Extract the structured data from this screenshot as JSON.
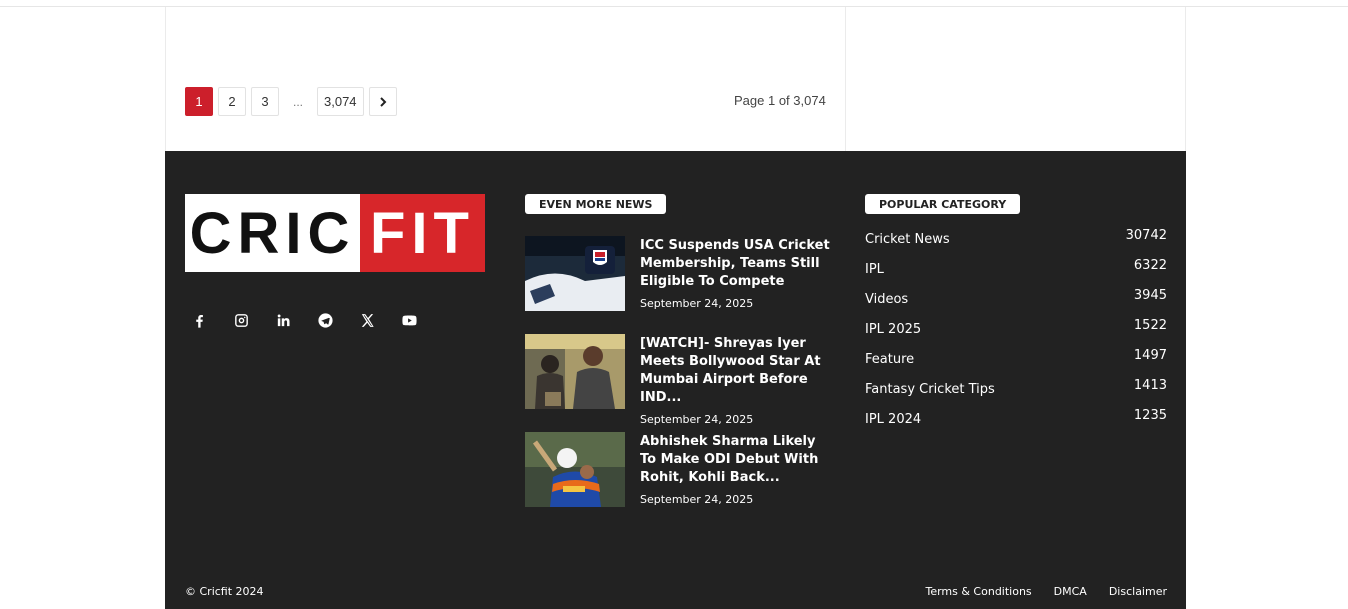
{
  "pagination": {
    "pages": [
      "1",
      "2",
      "3"
    ],
    "ellipsis": "...",
    "last_page": "3,074",
    "next_icon": "chevron-right-icon",
    "page_info": "Page 1 of 3,074"
  },
  "footer": {
    "logo": {
      "left": "CRIC",
      "right": "FIT"
    },
    "socials": [
      "facebook-icon",
      "instagram-icon",
      "linkedin-icon",
      "telegram-icon",
      "x-icon",
      "youtube-icon"
    ],
    "news": {
      "title": "EVEN MORE NEWS",
      "items": [
        {
          "title": "ICC Suspends USA Cricket Membership, Teams Still Eligible To Compete",
          "date": "September 24, 2025"
        },
        {
          "title": "[WATCH]- Shreyas Iyer Meets Bollywood Star At Mumbai Airport Before IND...",
          "date": "September 24, 2025"
        },
        {
          "title": "Abhishek Sharma Likely To Make ODI Debut With Rohit, Kohli Back...",
          "date": "September 24, 2025"
        }
      ]
    },
    "categories": {
      "title": "POPULAR CATEGORY",
      "items": [
        {
          "name": "Cricket News",
          "count": "30742"
        },
        {
          "name": "IPL",
          "count": "6322"
        },
        {
          "name": "Videos",
          "count": "3945"
        },
        {
          "name": "IPL 2025",
          "count": "1522"
        },
        {
          "name": "Feature",
          "count": "1497"
        },
        {
          "name": "Fantasy Cricket Tips",
          "count": "1413"
        },
        {
          "name": "IPL 2024",
          "count": "1235"
        }
      ]
    },
    "copyright": "© Cricfit 2024",
    "links": [
      "Terms & Conditions",
      "DMCA",
      "Disclaimer"
    ]
  },
  "colors": {
    "accent": "#cc1f2b",
    "footer_bg": "#222222",
    "logo_red": "#d7262a"
  }
}
